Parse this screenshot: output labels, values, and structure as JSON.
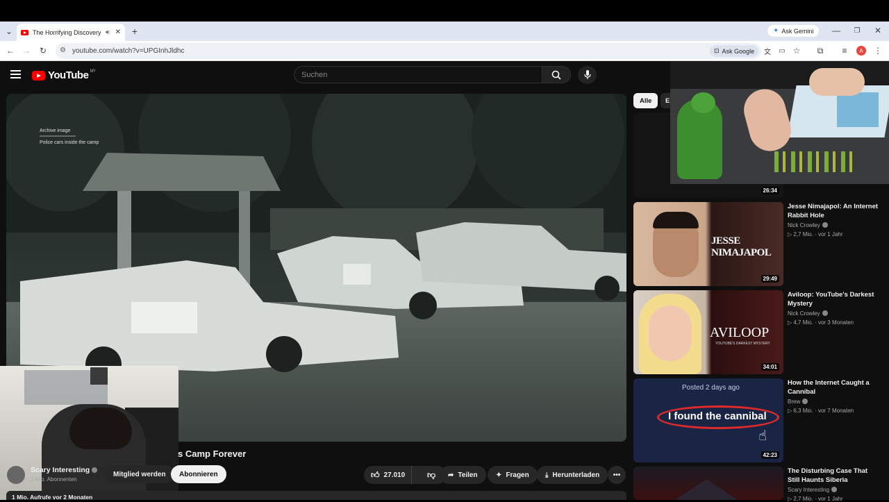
{
  "browser": {
    "tab_title": "The Horrifying Discovery Th",
    "url": "youtube.com/watch?v=UPGInhJldhc",
    "ask_gemini": "Ask Gemini",
    "ask_google": "Ask Google",
    "profile_initial": "A"
  },
  "youtube": {
    "logo_text": "YouTube",
    "region": "MY",
    "search_placeholder": "Suchen"
  },
  "video": {
    "overlay_line1": "Archive image",
    "overlay_line2": "Police cars inside the camp",
    "title_visible": "s Camp Forever",
    "channel": "Scary Interesting",
    "subscribers": "2 Mio. Abonnenten",
    "join_label": "Mitglied werden",
    "subscribe_label": "Abonnieren",
    "likes": "27.010",
    "share_label": "Teilen",
    "ask_label": "Fragen",
    "download_label": "Herunterladen",
    "views_partial": "1 Mio. Aufrufe  vor 2 Monaten"
  },
  "filters": {
    "all": "Alle",
    "next_partial": "Er"
  },
  "recommendations": [
    {
      "duration": "26:34"
    },
    {
      "title": "Jesse Nimajapol: An Internet Rabbit Hole",
      "channel": "Nick Crowley",
      "views": "2,7 Mio.",
      "age": "vor 1 Jahr",
      "duration": "29:49",
      "thumb_text": "JESSE NIMAJAPOL"
    },
    {
      "title": "Aviloop: YouTube's Darkest Mystery",
      "channel": "Nick Crowley",
      "views": "4,7 Mio.",
      "age": "vor 3 Monaten",
      "duration": "34:01",
      "thumb_text": "AVILOOP",
      "thumb_sub": "YOUTUBE'S DARKEST MYSTERY"
    },
    {
      "title": "How the Internet Caught a Cannibal",
      "channel": "Brew",
      "views": "6,3 Mio.",
      "age": "vor 7 Monaten",
      "duration": "42:23",
      "thumb_text": "I found the cannibal",
      "thumb_post": "Posted 2 days ago"
    },
    {
      "title": "The Disturbing Case That Still Haunts Siberia",
      "channel": "Scary Interesting",
      "views": "2,7 Mio.",
      "age": "vor 1 Jahr"
    }
  ],
  "colors": {
    "youtube_red": "#ff0000",
    "bg": "#0f0f0f",
    "chip": "#272727"
  }
}
